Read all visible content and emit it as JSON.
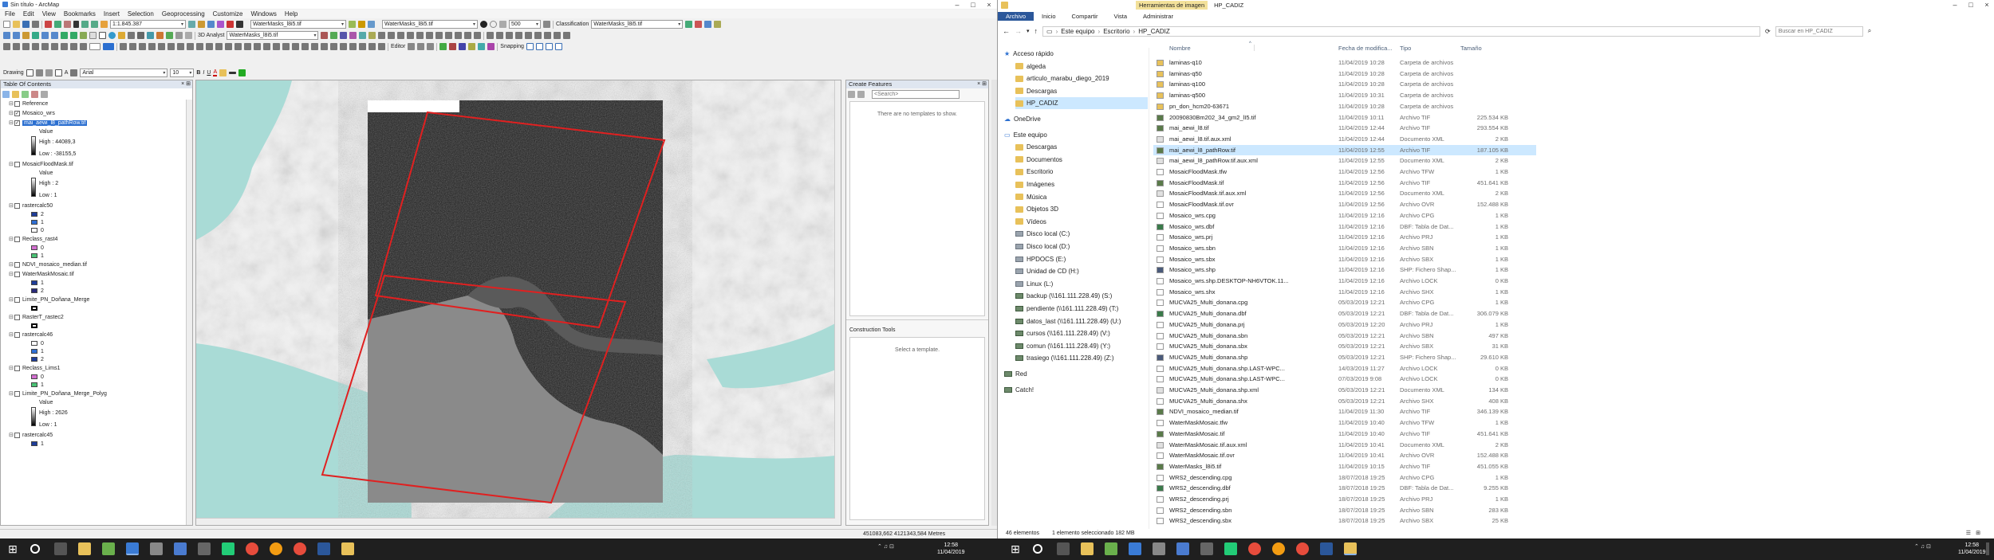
{
  "arcmap": {
    "title": "Sin título - ArcMap",
    "menu": [
      "File",
      "Edit",
      "View",
      "Bookmarks",
      "Insert",
      "Selection",
      "Geoprocessing",
      "Customize",
      "Windows",
      "Help"
    ],
    "scale": "1:1.845.387",
    "layer_combo1": "WaterMasks_l8i5.tif",
    "layer_combo2": "WaterMasks_l8i5.tif",
    "zoom_value": "500",
    "classification_label": "Classification",
    "classification_layer": "WaterMasks_l8i5.tif",
    "analyst_label": "3D Analyst",
    "analyst_layer": "WaterMasks_l8i5.tif",
    "editor_label": "Editor",
    "snapping_label": "Snapping",
    "drawing_label": "Drawing",
    "font_name": "Arial",
    "font_size": "10",
    "bold": "B",
    "italic": "I",
    "underline": "U",
    "font_color": "A",
    "status_coords": "451083,662  4121343,584 Metres"
  },
  "toc": {
    "title": "Table Of Contents",
    "rows": [
      {
        "label": "Reference",
        "check": false,
        "type": "layer"
      },
      {
        "label": "Mosaico_wrs",
        "check": true,
        "type": "layer"
      },
      {
        "label": "mai_aewi_l8_pathRow.tif",
        "check": true,
        "type": "selected"
      },
      {
        "label": "Value",
        "type": "legend-title"
      },
      {
        "label": "High : 44089,3",
        "type": "legend-high"
      },
      {
        "label": "Low : -38155,5",
        "type": "legend-low"
      },
      {
        "label": "MosaicFloodMask.tif",
        "check": false,
        "type": "layer"
      },
      {
        "label": "Value",
        "type": "legend-title"
      },
      {
        "label": "High : 2",
        "type": "legend-high"
      },
      {
        "label": "Low : 1",
        "type": "legend-low"
      },
      {
        "label": "rastercalc50",
        "check": false,
        "type": "layer"
      },
      {
        "label": "2",
        "type": "class",
        "color": "#1f3d99"
      },
      {
        "label": "1",
        "type": "class",
        "color": "#2f6fd4"
      },
      {
        "label": "0",
        "type": "class",
        "color": "#ffffff"
      },
      {
        "label": "Reclass_rast4",
        "check": false,
        "type": "layer"
      },
      {
        "label": "0",
        "type": "class",
        "color": "#d36fd0"
      },
      {
        "label": "1",
        "type": "class",
        "color": "#49c274"
      },
      {
        "label": "NDVI_mosaico_median.tif",
        "check": false,
        "type": "layer"
      },
      {
        "label": "WaterMaskMosaic.tif",
        "check": false,
        "type": "layer"
      },
      {
        "label": "1",
        "type": "class",
        "color": "#1f3d99"
      },
      {
        "label": "2",
        "type": "class",
        "color": "#2a2a7a"
      },
      {
        "label": "Limite_PN_Doñana_Merge",
        "check": false,
        "type": "layer"
      },
      {
        "label": "",
        "type": "polygon",
        "color": "#ffffff"
      },
      {
        "label": "RasterT_rastec2",
        "check": false,
        "type": "layer"
      },
      {
        "label": "",
        "type": "polygon",
        "color": "#ffffff"
      },
      {
        "label": "rastercalc46",
        "check": false,
        "type": "layer"
      },
      {
        "label": "0",
        "type": "class",
        "color": "#ffffff"
      },
      {
        "label": "1",
        "type": "class",
        "color": "#2f6fd4"
      },
      {
        "label": "2",
        "type": "class",
        "color": "#1f3d99"
      },
      {
        "label": "Reclass_Lims1",
        "check": false,
        "type": "layer"
      },
      {
        "label": "0",
        "type": "class",
        "color": "#d36fd0"
      },
      {
        "label": "1",
        "type": "class",
        "color": "#49c274"
      },
      {
        "label": "Limite_PN_Doñana_Merge_Polyg",
        "check": false,
        "type": "layer"
      },
      {
        "label": "Value",
        "type": "legend-title"
      },
      {
        "label": "High : 2626",
        "type": "legend-high"
      },
      {
        "label": "Low : 1",
        "type": "legend-low"
      },
      {
        "label": "rastercalc45",
        "check": false,
        "type": "layer"
      },
      {
        "label": "1",
        "type": "class",
        "color": "#1f3d99"
      }
    ]
  },
  "create_features": {
    "title": "Create Features",
    "search_placeholder": "<Search>",
    "empty_text": "There are no templates to show.",
    "construction_title": "Construction Tools",
    "construction_text": "Select a template."
  },
  "explorer": {
    "title": "HP_CADIZ",
    "ribbon_context": "Herramientas de imagen",
    "tabs": [
      "Archivo",
      "Inicio",
      "Compartir",
      "Vista",
      "Administrar"
    ],
    "address": [
      "Este equipo",
      "Escritorio",
      "HP_CADIZ"
    ],
    "search_placeholder": "Buscar en HP_CADIZ",
    "columns": [
      "Nombre",
      "Fecha de modifica...",
      "Tipo",
      "Tamaño"
    ],
    "nav": [
      {
        "label": "Acceso rápido",
        "icon": "star",
        "indent": 0
      },
      {
        "label": "algeda",
        "icon": "folder",
        "indent": 1
      },
      {
        "label": "articulo_marabu_diego_2019",
        "icon": "folder",
        "indent": 1
      },
      {
        "label": "Descargas",
        "icon": "folder",
        "indent": 1
      },
      {
        "label": "HP_CADIZ",
        "icon": "folder",
        "indent": 1,
        "selected": true
      },
      {
        "label": "OneDrive",
        "icon": "cloud",
        "indent": 0
      },
      {
        "label": "Este equipo",
        "icon": "pc",
        "indent": 0
      },
      {
        "label": "Descargas",
        "icon": "folder",
        "indent": 1
      },
      {
        "label": "Documentos",
        "icon": "folder",
        "indent": 1
      },
      {
        "label": "Escritorio",
        "icon": "folder",
        "indent": 1
      },
      {
        "label": "Imágenes",
        "icon": "folder",
        "indent": 1
      },
      {
        "label": "Música",
        "icon": "folder",
        "indent": 1
      },
      {
        "label": "Objetos 3D",
        "icon": "folder",
        "indent": 1
      },
      {
        "label": "Vídeos",
        "icon": "folder",
        "indent": 1
      },
      {
        "label": "Disco local (C:)",
        "icon": "drive",
        "indent": 1
      },
      {
        "label": "Disco local (D:)",
        "icon": "drive",
        "indent": 1
      },
      {
        "label": "HPDOCS (E:)",
        "icon": "drive",
        "indent": 1
      },
      {
        "label": "Unidad de CD (H:)",
        "icon": "drive",
        "indent": 1
      },
      {
        "label": "Linux (L:)",
        "icon": "drive",
        "indent": 1
      },
      {
        "label": "backup (\\\\161.111.228.49) (S:)",
        "icon": "net",
        "indent": 1
      },
      {
        "label": "pendiente (\\\\161.111.228.49) (T:)",
        "icon": "net",
        "indent": 1
      },
      {
        "label": "datos_last (\\\\161.111.228.49) (U:)",
        "icon": "net",
        "indent": 1
      },
      {
        "label": "cursos (\\\\161.111.228.49) (V:)",
        "icon": "net",
        "indent": 1
      },
      {
        "label": "comun (\\\\161.111.228.49) (Y:)",
        "icon": "net",
        "indent": 1
      },
      {
        "label": "trasiego (\\\\161.111.228.49) (Z:)",
        "icon": "net",
        "indent": 1
      },
      {
        "label": "Red",
        "icon": "net",
        "indent": 0
      },
      {
        "label": "Catch!",
        "icon": "net",
        "indent": 0
      }
    ],
    "files": [
      [
        "laminas-q10",
        "11/04/2019 10:28",
        "Carpeta de archivos",
        "",
        "folder"
      ],
      [
        "laminas-q50",
        "11/04/2019 10:28",
        "Carpeta de archivos",
        "",
        "folder"
      ],
      [
        "laminas-q100",
        "11/04/2019 10:28",
        "Carpeta de archivos",
        "",
        "folder"
      ],
      [
        "laminas-q500",
        "11/04/2019 10:31",
        "Carpeta de archivos",
        "",
        "folder"
      ],
      [
        "pn_don_hcm20-63671",
        "11/04/2019 10:28",
        "Carpeta de archivos",
        "",
        "folder"
      ],
      [
        "20090830Bm202_34_gm2_lI5.tif",
        "11/04/2019 10:11",
        "Archivo TIF",
        "225.534 KB",
        "tif"
      ],
      [
        "mai_aewi_l8.tif",
        "11/04/2019 12:44",
        "Archivo TIF",
        "293.554 KB",
        "tif"
      ],
      [
        "mai_aewi_l8.tif.aux.xml",
        "11/04/2019 12:44",
        "Documento XML",
        "2 KB",
        "xml"
      ],
      [
        "mai_aewi_l8_pathRow.tif",
        "11/04/2019 12:55",
        "Archivo TIF",
        "187.105 KB",
        "tif"
      ],
      [
        "mai_aewi_l8_pathRow.tif.aux.xml",
        "11/04/2019 12:55",
        "Documento XML",
        "2 KB",
        "xml"
      ],
      [
        "MosaicFloodMask.tfw",
        "11/04/2019 12:56",
        "Archivo TFW",
        "1 KB",
        "file"
      ],
      [
        "MosaicFloodMask.tif",
        "11/04/2019 12:56",
        "Archivo TIF",
        "451.641 KB",
        "tif"
      ],
      [
        "MosaicFloodMask.tif.aux.xml",
        "11/04/2019 12:56",
        "Documento XML",
        "2 KB",
        "xml"
      ],
      [
        "MosaicFloodMask.tif.ovr",
        "11/04/2019 12:56",
        "Archivo OVR",
        "152.488 KB",
        "file"
      ],
      [
        "Mosaico_wrs.cpg",
        "11/04/2019 12:16",
        "Archivo CPG",
        "1 KB",
        "file"
      ],
      [
        "Mosaico_wrs.dbf",
        "11/04/2019 12:16",
        "DBF: Tabla de Dat...",
        "1 KB",
        "dbf"
      ],
      [
        "Mosaico_wrs.prj",
        "11/04/2019 12:16",
        "Archivo PRJ",
        "1 KB",
        "file"
      ],
      [
        "Mosaico_wrs.sbn",
        "11/04/2019 12:16",
        "Archivo SBN",
        "1 KB",
        "file"
      ],
      [
        "Mosaico_wrs.sbx",
        "11/04/2019 12:16",
        "Archivo SBX",
        "1 KB",
        "file"
      ],
      [
        "Mosaico_wrs.shp",
        "11/04/2019 12:16",
        "SHP: Fichero Shap...",
        "1 KB",
        "shp"
      ],
      [
        "Mosaico_wrs.shp.DESKTOP-NH6VTOK.11...",
        "11/04/2019 12:16",
        "Archivo LOCK",
        "0 KB",
        "file"
      ],
      [
        "Mosaico_wrs.shx",
        "11/04/2019 12:16",
        "Archivo SHX",
        "1 KB",
        "file"
      ],
      [
        "MUCVA25_Multi_donana.cpg",
        "05/03/2019 12:21",
        "Archivo CPG",
        "1 KB",
        "file"
      ],
      [
        "MUCVA25_Multi_donana.dbf",
        "05/03/2019 12:21",
        "DBF: Tabla de Dat...",
        "306.079 KB",
        "dbf"
      ],
      [
        "MUCVA25_Multi_donana.prj",
        "05/03/2019 12:20",
        "Archivo PRJ",
        "1 KB",
        "file"
      ],
      [
        "MUCVA25_Multi_donana.sbn",
        "05/03/2019 12:21",
        "Archivo SBN",
        "497 KB",
        "file"
      ],
      [
        "MUCVA25_Multi_donana.sbx",
        "05/03/2019 12:21",
        "Archivo SBX",
        "31 KB",
        "file"
      ],
      [
        "MUCVA25_Multi_donana.shp",
        "05/03/2019 12:21",
        "SHP: Fichero Shap...",
        "29.610 KB",
        "shp"
      ],
      [
        "MUCVA25_Multi_donana.shp.LAST-WPC...",
        "14/03/2019 11:27",
        "Archivo LOCK",
        "0 KB",
        "file"
      ],
      [
        "MUCVA25_Multi_donana.shp.LAST-WPC...",
        "07/03/2019 9:08",
        "Archivo LOCK",
        "0 KB",
        "file"
      ],
      [
        "MUCVA25_Multi_donana.shp.xml",
        "05/03/2019 12:21",
        "Documento XML",
        "134 KB",
        "xml"
      ],
      [
        "MUCVA25_Multi_donana.shx",
        "05/03/2019 12:21",
        "Archivo SHX",
        "408 KB",
        "file"
      ],
      [
        "NDVI_mosaico_median.tif",
        "11/04/2019 11:30",
        "Archivo TIF",
        "346.139 KB",
        "tif"
      ],
      [
        "WaterMaskMosaic.tfw",
        "11/04/2019 10:40",
        "Archivo TFW",
        "1 KB",
        "file"
      ],
      [
        "WaterMaskMosaic.tif",
        "11/04/2019 10:40",
        "Archivo TIF",
        "451.641 KB",
        "tif"
      ],
      [
        "WaterMaskMosaic.tif.aux.xml",
        "11/04/2019 10:41",
        "Documento XML",
        "2 KB",
        "xml"
      ],
      [
        "WaterMaskMosaic.tif.ovr",
        "11/04/2019 10:41",
        "Archivo OVR",
        "152.488 KB",
        "file"
      ],
      [
        "WaterMasks_l8i5.tif",
        "11/04/2019 10:15",
        "Archivo TIF",
        "451.055 KB",
        "tif"
      ],
      [
        "WRS2_descending.cpg",
        "18/07/2018 19:25",
        "Archivo CPG",
        "1 KB",
        "file"
      ],
      [
        "WRS2_descending.dbf",
        "18/07/2018 19:25",
        "DBF: Tabla de Dat...",
        "9.255 KB",
        "dbf"
      ],
      [
        "WRS2_descending.prj",
        "18/07/2018 19:25",
        "Archivo PRJ",
        "1 KB",
        "file"
      ],
      [
        "WRS2_descending.sbn",
        "18/07/2018 19:25",
        "Archivo SBN",
        "283 KB",
        "file"
      ],
      [
        "WRS2_descending.sbx",
        "18/07/2018 19:25",
        "Archivo SBX",
        "25 KB",
        "file"
      ]
    ],
    "selected_index": 8,
    "status_count": "46 elementos",
    "status_selected": "1 elemento seleccionado  182 MB"
  },
  "taskbar": {
    "time": "12:58",
    "date": "11/04/2019",
    "time2": "12:58",
    "date2": "11/04/2019"
  },
  "colors": {
    "accent": "#2b579a",
    "selection": "#cce8ff",
    "folder": "#e8c15a",
    "red_frame": "#e02020",
    "sea": "#a9dbd6"
  }
}
